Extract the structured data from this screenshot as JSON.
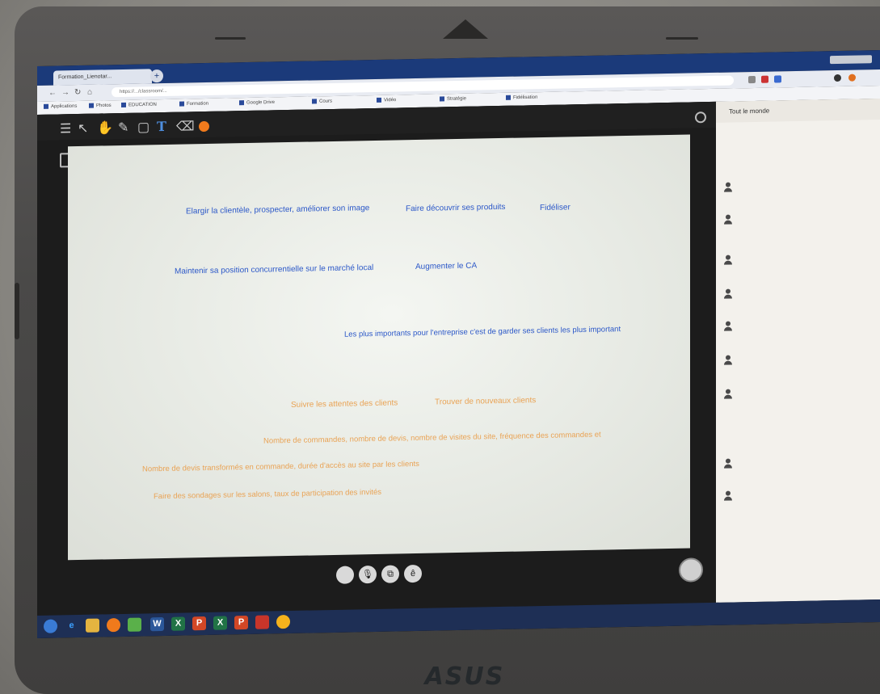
{
  "browser": {
    "tab_title": "Formation_Lienotar...",
    "url": "https://.../classroom/...",
    "bookmarks": [
      "Applications",
      "Photos",
      "EDUCATION",
      "Formation",
      "Google Drive",
      "Cours",
      "Vidéo",
      "Stratégie",
      "Fidélisation"
    ]
  },
  "toolbar": {
    "menu_icon": "menu-icon",
    "tools": [
      "pointer-icon",
      "hand-icon",
      "pen-icon",
      "rectangle-icon",
      "text-icon",
      "eraser-icon",
      "color-dot-icon"
    ],
    "text_tool_glyph": "T",
    "accent_color": "#f07a1c"
  },
  "board": {
    "blue_notes": [
      "Elargir la clientèle, prospecter, améliorer son image",
      "Faire découvrir ses produits",
      "Fidéliser",
      "Maintenir sa position concurrentielle sur le marché local",
      "Augmenter le CA",
      "Les plus importants pour l'entreprise c'est de garder ses clients les plus important"
    ],
    "orange_notes": [
      "Suivre les attentes des clients",
      "Trouver de nouveaux clients",
      "Nombre de commandes, nombre de devis, nombre de visites du site, fréquence des commandes et",
      "Nombre de devis transformés en commande, durée d'accès au site par les clients",
      "Faire des sondages sur les salons, taux de participation des invités"
    ],
    "blue_color": "#2c58c8",
    "orange_color": "#e9a355"
  },
  "controls": {
    "mic_label": "🎙",
    "screen_label": "⧉",
    "share_label": "ê"
  },
  "chat": {
    "title": "Tout le monde",
    "messages": [
      {
        "name": "",
        "text": "",
        "time": ""
      },
      {
        "name": "",
        "text": "",
        "time": ""
      },
      {
        "name": "",
        "text": "",
        "time": ""
      },
      {
        "name": "",
        "text": "",
        "time": ""
      },
      {
        "name": "",
        "text": "",
        "time": ""
      },
      {
        "name": "",
        "text": "",
        "time": ""
      },
      {
        "name": "",
        "text": "",
        "time": ""
      },
      {
        "name": "",
        "text": "",
        "time": ""
      },
      {
        "name": "",
        "text": "",
        "time": ""
      }
    ],
    "input_placeholder": ""
  },
  "taskbar": {
    "clock": ""
  },
  "laptop": {
    "brand": "ASUS"
  }
}
